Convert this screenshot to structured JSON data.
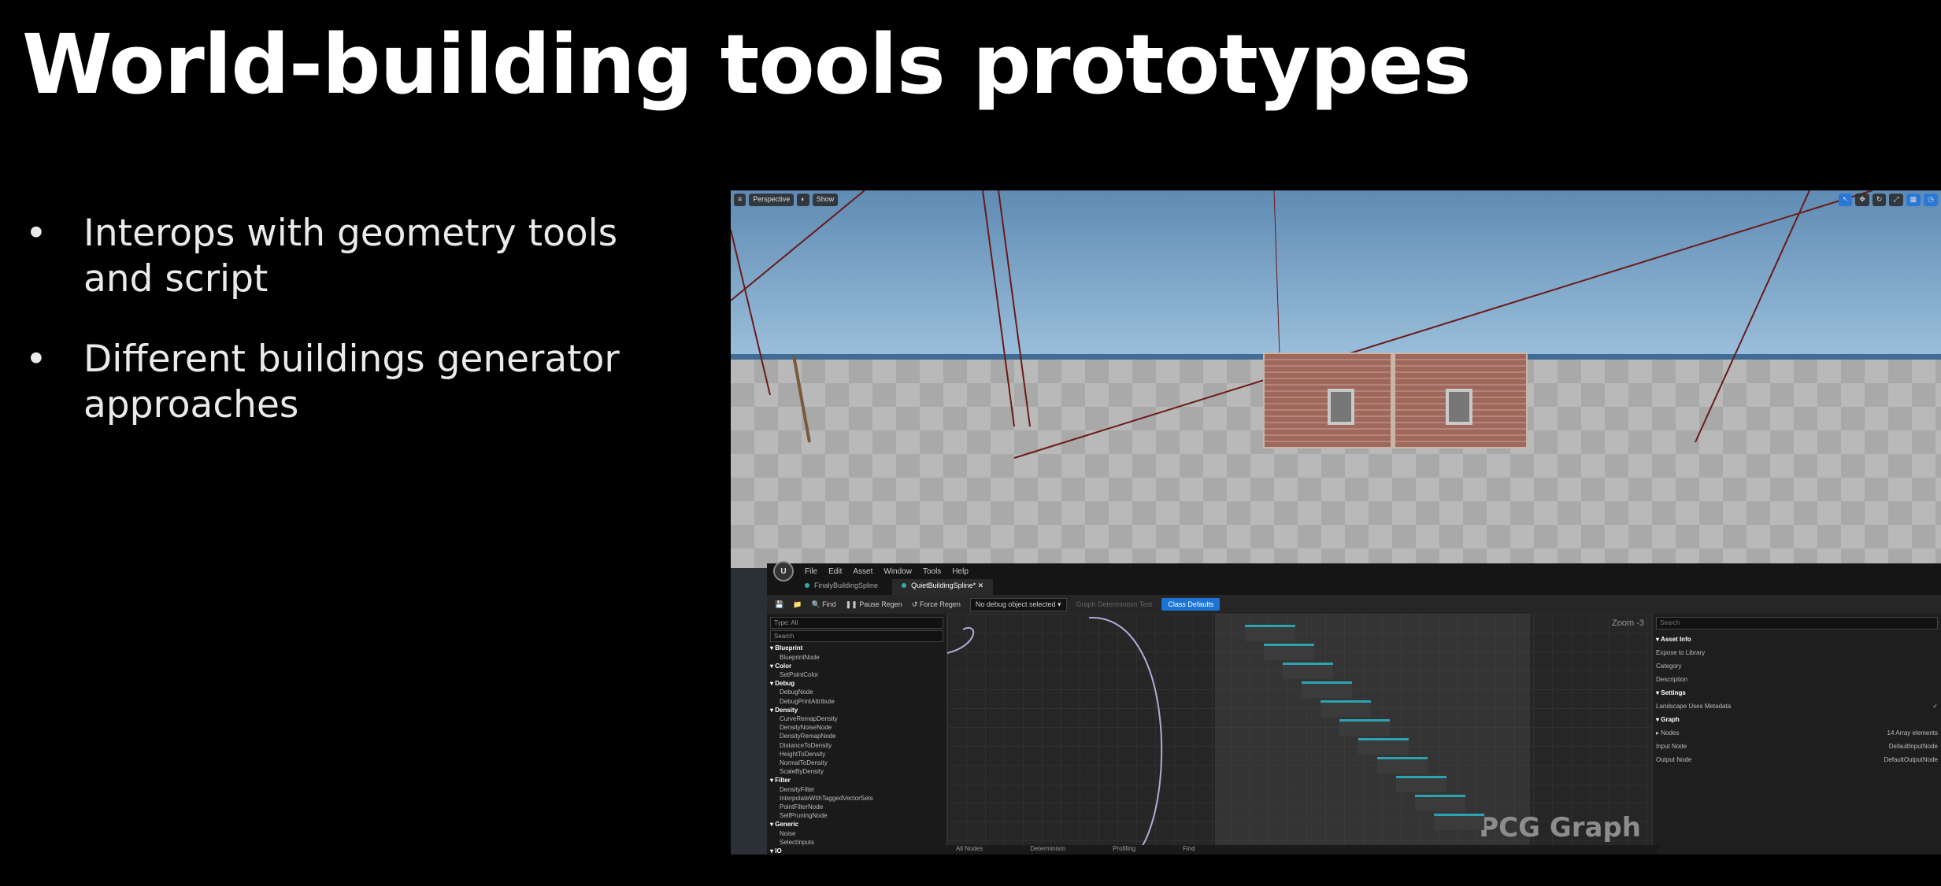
{
  "slide": {
    "title": "World-building tools prototypes",
    "bullets": [
      {
        "line1": "Interops with geometry tools",
        "line2": "and script"
      },
      {
        "line1": "Different buildings generator",
        "line2": "approaches"
      }
    ]
  },
  "viewport": {
    "mode_label": "Perspective",
    "view_label": "Show"
  },
  "editor": {
    "menu": [
      "File",
      "Edit",
      "Asset",
      "Window",
      "Tools",
      "Help"
    ],
    "tabs": [
      "FinalyBuildingSpline",
      "QuietBuildingSpline*"
    ],
    "toolbar": {
      "find": "Find",
      "pause_regen": "Pause Regen",
      "force_regen": "Force Regen",
      "debug_select": "No debug object selected",
      "graph_determinism": "Graph Determinism Test",
      "class_defaults": "Class Defaults"
    },
    "palette": {
      "type_label": "Type: All",
      "search_placeholder": "Search",
      "rows": [
        {
          "kind": "cat",
          "text": "▾ Blueprint"
        },
        {
          "kind": "item",
          "text": "BlueprintNode"
        },
        {
          "kind": "cat",
          "text": "▾ Color"
        },
        {
          "kind": "item",
          "text": "SetPointColor"
        },
        {
          "kind": "cat",
          "text": "▾ Debug"
        },
        {
          "kind": "item",
          "text": "DebugNode"
        },
        {
          "kind": "item",
          "text": "DebugPrintAttribute"
        },
        {
          "kind": "cat",
          "text": "▾ Density"
        },
        {
          "kind": "item",
          "text": "CurveRemapDensity"
        },
        {
          "kind": "item",
          "text": "DensityNoiseNode"
        },
        {
          "kind": "item",
          "text": "DensityRemapNode"
        },
        {
          "kind": "item",
          "text": "DistanceToDensity"
        },
        {
          "kind": "item",
          "text": "HeightToDensity"
        },
        {
          "kind": "item",
          "text": "NormalToDensity"
        },
        {
          "kind": "item",
          "text": "ScaleByDensity"
        },
        {
          "kind": "cat",
          "text": "▾ Filter"
        },
        {
          "kind": "item",
          "text": "DensityFilter"
        },
        {
          "kind": "item",
          "text": "InterpolateWithTaggedVectorSets"
        },
        {
          "kind": "item",
          "text": "PointFilterNode"
        },
        {
          "kind": "item",
          "text": "SelfPruningNode"
        },
        {
          "kind": "cat",
          "text": "▾ Generic"
        },
        {
          "kind": "item",
          "text": "Noise"
        },
        {
          "kind": "item",
          "text": "SelectInputs"
        },
        {
          "kind": "cat",
          "text": "▾ IO"
        }
      ]
    },
    "graph": {
      "zoom_label": "Zoom -3",
      "watermark": "PCG Graph"
    },
    "details": {
      "search_placeholder": "Search",
      "rows": [
        {
          "kind": "head",
          "label": "▾ Asset Info",
          "value": ""
        },
        {
          "kind": "row",
          "label": "Expose to Library",
          "value": ""
        },
        {
          "kind": "row",
          "label": "Category",
          "value": ""
        },
        {
          "kind": "row",
          "label": "Description",
          "value": ""
        },
        {
          "kind": "head",
          "label": "▾ Settings",
          "value": ""
        },
        {
          "kind": "row",
          "label": "Landscape Uses Metadata",
          "value": "✓"
        },
        {
          "kind": "head",
          "label": "▾ Graph",
          "value": ""
        },
        {
          "kind": "row",
          "label": "▸ Nodes",
          "value": "14 Array elements"
        },
        {
          "kind": "row",
          "label": "Input Node",
          "value": "DefaultInputNode"
        },
        {
          "kind": "row",
          "label": "Output Node",
          "value": "DefaultOutputNode"
        }
      ]
    },
    "status": [
      "All Nodes",
      "Determinism",
      "Profiling",
      "Find"
    ]
  },
  "colors": {
    "background": "#000000",
    "accent": "#1b73d3",
    "node_header": "#2aa4b0"
  }
}
